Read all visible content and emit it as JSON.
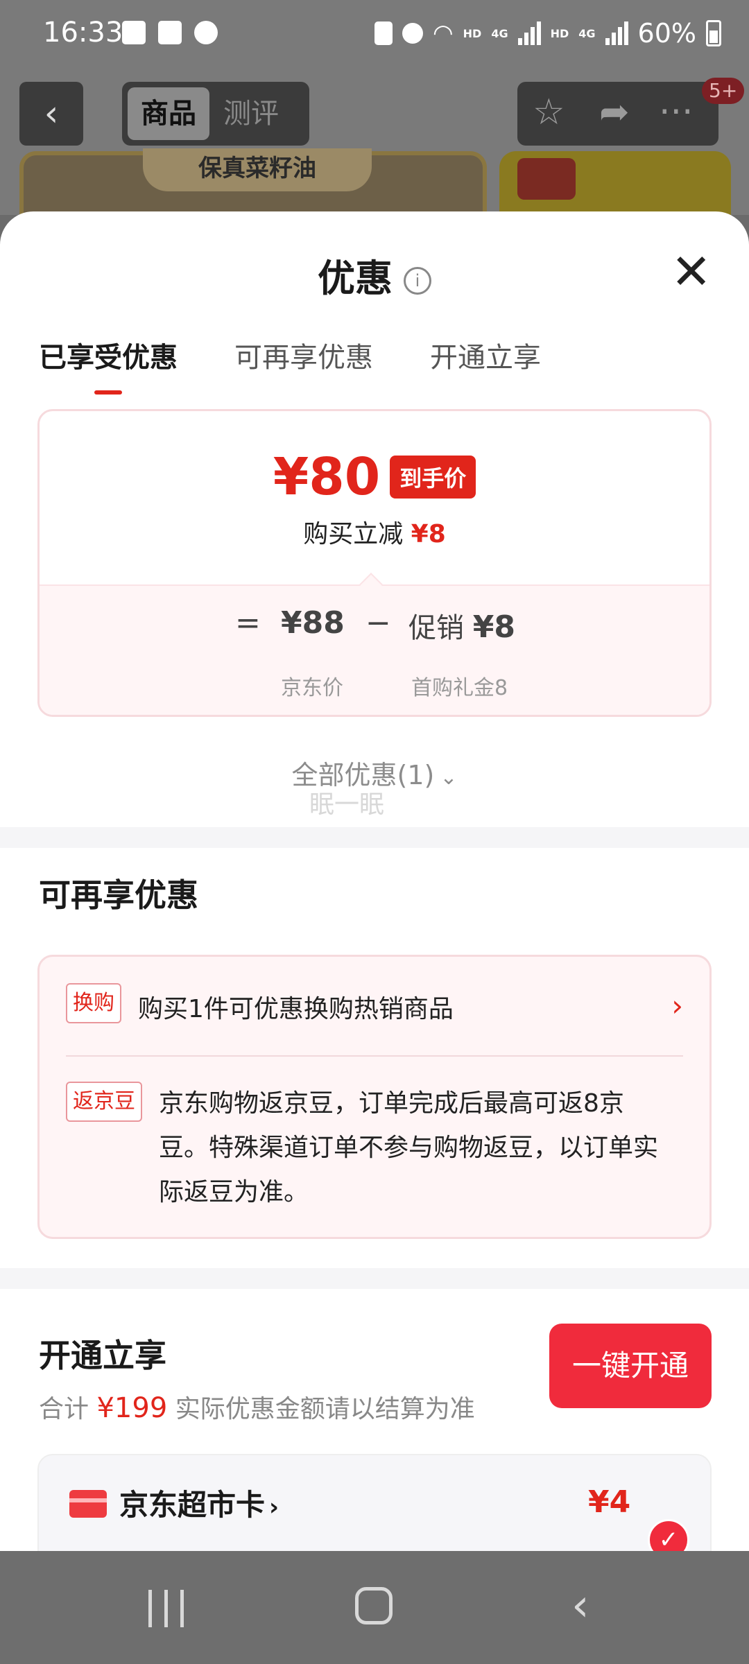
{
  "status_bar": {
    "time": "16:33",
    "network_hd1": "HD",
    "network_4g1": "4G",
    "network_hd2": "HD",
    "network_4g2": "4G",
    "battery": "60%"
  },
  "product_page": {
    "tab_goods": "商品",
    "tab_review": "测评",
    "badge": "5+",
    "banner": "保真菜籽油"
  },
  "sheet": {
    "title": "优惠",
    "tabs": [
      "已享受优惠",
      "可再享优惠",
      "开通立享"
    ],
    "enjoyed": {
      "final_price": "¥80",
      "final_price_tag": "到手价",
      "save_prefix": "购买立减",
      "save_amount": "¥8",
      "equals": "=",
      "jd_price": "¥88",
      "minus": "−",
      "promo_label": "促销",
      "promo_amount": "¥8",
      "jd_price_label": "京东价",
      "promo_detail": "首购礼金8"
    },
    "all_discounts": "全部优惠(1)",
    "watermark": "眠一眠",
    "more": {
      "title": "可再享优惠",
      "items": [
        {
          "tag": "换购",
          "text": "购买1件可优惠换购热销商品"
        },
        {
          "tag": "返京豆",
          "text": "京东购物返京豆，订单完成后最高可返8京豆。特殊渠道订单不参与购物返豆，以订单实际返豆为准。"
        }
      ]
    },
    "open": {
      "title": "开通立享",
      "total_label": "合计",
      "total_amount": "¥199",
      "note": "实际优惠金额请以结算为准",
      "button": "一键开通",
      "card_name": "京东超市卡",
      "card_price": "¥4"
    }
  },
  "icons": {
    "close": "close-icon",
    "info": "info-icon",
    "chevron_right": "chevron-right-icon",
    "chevron_down": "chevron-down-icon",
    "check": "check-icon"
  },
  "colors": {
    "accent_red": "#e1251b",
    "button_red": "#f02b3c",
    "card_tint": "#fff5f6"
  }
}
